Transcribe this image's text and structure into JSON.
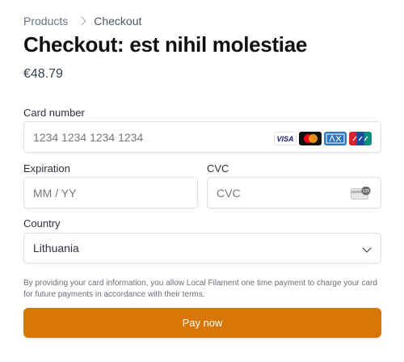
{
  "breadcrumb": {
    "items": [
      "Products",
      "Checkout"
    ]
  },
  "page": {
    "title": "Checkout: est nihil molestiae",
    "price": "€48.79"
  },
  "form": {
    "card_number": {
      "label": "Card number",
      "placeholder": "1234 1234 1234 1234",
      "brands": [
        "visa-icon",
        "mastercard-icon",
        "amex-icon",
        "unionpay-icon"
      ],
      "visa_text": "VISA"
    },
    "expiration": {
      "label": "Expiration",
      "placeholder": "MM / YY"
    },
    "cvc": {
      "label": "CVC",
      "placeholder": "CVC",
      "icon_text": "135"
    },
    "country": {
      "label": "Country",
      "value": "Lithuania"
    }
  },
  "terms": "By providing your card information, you allow Local Filament one time payment to charge your card for future payments in accordance with their terms.",
  "pay_button": {
    "label": "Pay now",
    "color": "#d97706"
  }
}
